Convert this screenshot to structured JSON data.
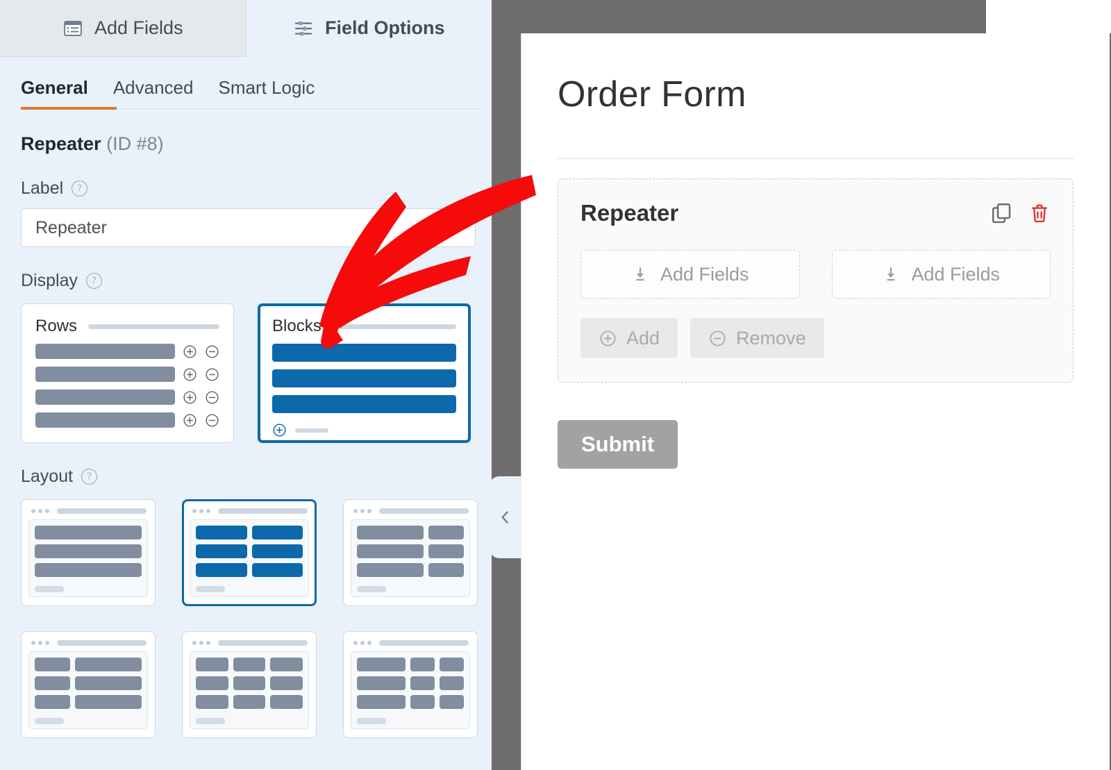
{
  "top_tabs": [
    {
      "label": "Add Fields",
      "icon": "list-icon",
      "active": false
    },
    {
      "label": "Field Options",
      "icon": "sliders-icon",
      "active": true
    }
  ],
  "sub_tabs": [
    {
      "label": "General",
      "active": true
    },
    {
      "label": "Advanced",
      "active": false
    },
    {
      "label": "Smart Logic",
      "active": false
    }
  ],
  "field": {
    "name": "Repeater",
    "id_text": "(ID #8)"
  },
  "options": {
    "label_heading": "Label",
    "label_value": "Repeater",
    "display_heading": "Display",
    "layout_heading": "Layout",
    "help_glyph": "?"
  },
  "display_choices": [
    {
      "title": "Rows",
      "selected": false,
      "bars": 4,
      "bar_style": "grey",
      "has_row_icons": true
    },
    {
      "title": "Blocks",
      "selected": true,
      "bars": 3,
      "bar_style": "blue",
      "has_add_footer": true
    }
  ],
  "layout_choices": [
    {
      "id": "one-column",
      "selected": false,
      "columns": [
        1,
        1,
        1
      ],
      "widths": [
        [
          100
        ],
        [
          100
        ],
        [
          100
        ]
      ],
      "style": "grey"
    },
    {
      "id": "two-column-equal",
      "selected": true,
      "columns": [
        2,
        2,
        2
      ],
      "widths": [
        [
          50,
          50
        ],
        [
          50,
          50
        ],
        [
          50,
          50
        ]
      ],
      "style": "blue"
    },
    {
      "id": "two-column-wide-left",
      "selected": false,
      "columns": [
        2,
        2,
        2
      ],
      "widths": [
        [
          65,
          35
        ],
        [
          65,
          35
        ],
        [
          65,
          35
        ]
      ],
      "style": "grey"
    },
    {
      "id": "two-column-narrow-left",
      "selected": false,
      "columns": [
        2,
        2,
        2
      ],
      "widths": [
        [
          35,
          65
        ],
        [
          35,
          65
        ],
        [
          35,
          65
        ]
      ],
      "style": "grey"
    },
    {
      "id": "three-column-equal",
      "selected": false,
      "columns": [
        3,
        3,
        3
      ],
      "widths": [
        [
          33,
          33,
          33
        ],
        [
          33,
          33,
          33
        ],
        [
          33,
          33,
          33
        ]
      ],
      "style": "grey"
    },
    {
      "id": "three-column-wide-left",
      "selected": false,
      "columns": [
        3,
        3,
        3
      ],
      "widths": [
        [
          50,
          25,
          25
        ],
        [
          50,
          25,
          25
        ],
        [
          50,
          25,
          25
        ]
      ],
      "style": "grey"
    }
  ],
  "preview": {
    "form_title": "Order Form",
    "repeater_label": "Repeater",
    "duplicate_icon": "copy-icon",
    "delete_icon": "trash-icon",
    "dropzones": [
      {
        "label": "Add Fields",
        "icon": "download-arrow-icon"
      },
      {
        "label": "Add Fields",
        "icon": "download-arrow-icon"
      }
    ],
    "buttons": [
      {
        "label": "Add",
        "icon": "circle-plus-icon"
      },
      {
        "label": "Remove",
        "icon": "circle-minus-icon"
      }
    ],
    "submit_label": "Submit",
    "collapse_icon": "chevron-left-icon"
  },
  "annotation": {
    "type": "arrow",
    "color": "#f60a0a",
    "points_to": "display-choice-blocks"
  },
  "colors": {
    "accent_blue": "#0c69ab",
    "accent_orange": "#e27730",
    "panel_bg": "#e9f1fb",
    "canvas_grey": "#6d6d6d",
    "bar_grey": "#808e9f",
    "delete_red": "#e02b2b",
    "arrow_red": "#f60a0a"
  }
}
